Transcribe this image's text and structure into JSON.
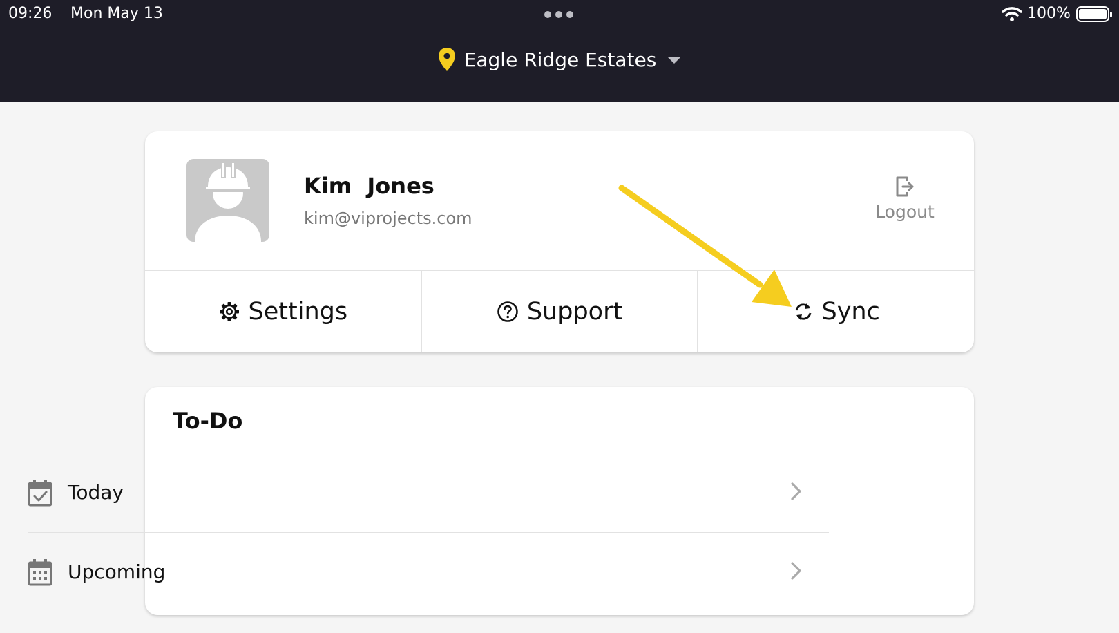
{
  "status_bar": {
    "time": "09:26",
    "date": "Mon May 13",
    "battery": "100%"
  },
  "header": {
    "project_name": "Eagle Ridge Estates"
  },
  "profile": {
    "name": "Kim  Jones",
    "email": "kim@viprojects.com",
    "logout_label": "Logout"
  },
  "actions": {
    "settings": "Settings",
    "support": "Support",
    "sync": "Sync"
  },
  "todo": {
    "title": "To-Do",
    "items": [
      {
        "label": "Today"
      },
      {
        "label": "Upcoming"
      }
    ]
  },
  "colors": {
    "accent": "#f5cd1f",
    "header_bg": "#1e1d28",
    "page_bg": "#f5f5f5"
  },
  "icons": [
    "map-pin-icon",
    "caret-down-icon",
    "worker-avatar-icon",
    "logout-icon",
    "gear-icon",
    "help-circle-icon",
    "sync-icon",
    "calendar-check-icon",
    "calendar-grid-icon",
    "chevron-right-icon",
    "wifi-icon",
    "battery-icon"
  ]
}
